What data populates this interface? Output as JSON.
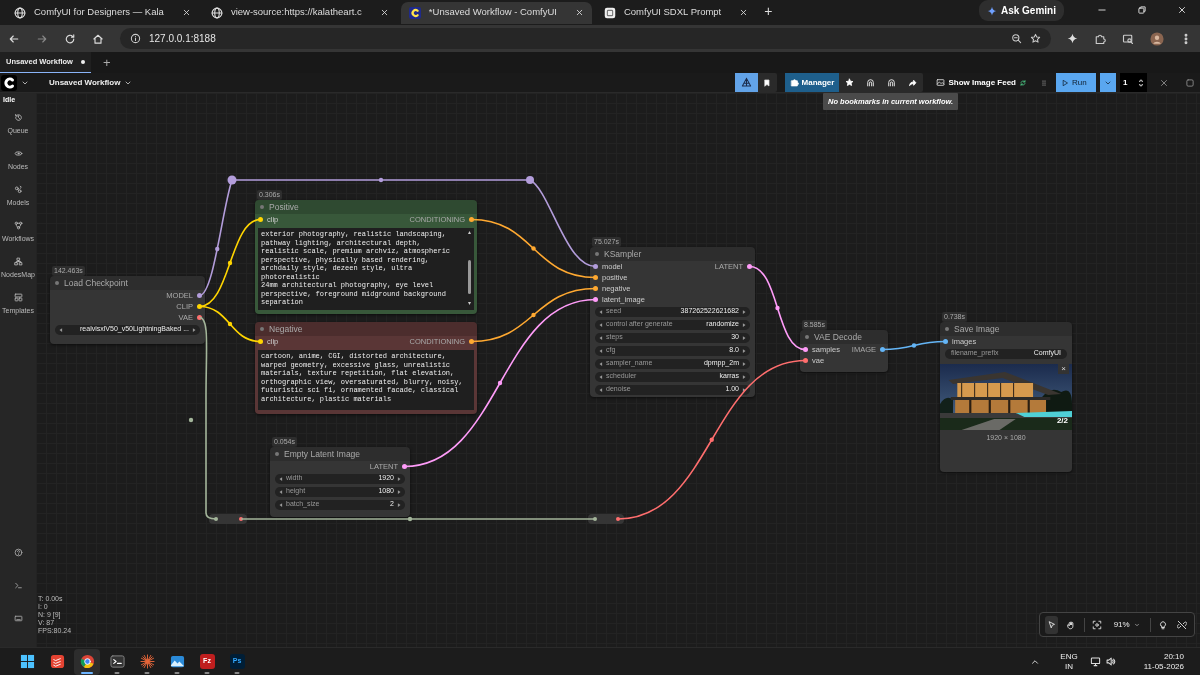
{
  "browser": {
    "tabs": [
      {
        "kind": "web",
        "title": "ComfyUI for Designers — Kala",
        "selected": false
      },
      {
        "kind": "web",
        "title": "view-source:https://kalatheart.c",
        "selected": false
      },
      {
        "kind": "comfy",
        "title": "*Unsaved Workflow - ComfyUI",
        "selected": true
      },
      {
        "kind": "app",
        "title": "ComfyUI SDXL Prompt",
        "selected": false
      }
    ],
    "new_tab": "+",
    "assistant": "Ask Gemini",
    "address": "127.0.0.1:8188"
  },
  "workflow_tabs": [
    {
      "label": "Unsaved Workflow",
      "selected": true,
      "unsaved": true
    }
  ],
  "add_workflow": "+",
  "menu": {
    "workflow_name": "Unsaved Workflow",
    "tools": [
      {
        "kind": "focus",
        "active": true
      },
      {
        "kind": "bookmark",
        "active": false
      }
    ],
    "manager": "Manager",
    "image_feed": "Show Image Feed",
    "run": "Run",
    "batch_count": "1",
    "tooltip": "No bookmarks in current workflow."
  },
  "status": "Idle",
  "sidebar": {
    "items": [
      {
        "kind": "queue",
        "label": "Queue"
      },
      {
        "kind": "nodes",
        "label": "Nodes"
      },
      {
        "kind": "models",
        "label": "Models"
      },
      {
        "kind": "workflows",
        "label": "Workflows"
      },
      {
        "kind": "map",
        "label": "NodesMap"
      },
      {
        "kind": "templates",
        "label": "Templates"
      }
    ]
  },
  "nodes": [
    {
      "kind": "loader",
      "title": "Load Checkpoint",
      "timing": "142.463s",
      "outputs": [
        {
          "label": "MODEL",
          "color": "#b39ddb"
        },
        {
          "label": "CLIP",
          "color": "#ffd500"
        },
        {
          "label": "VAE",
          "color": "#ff6e6e"
        }
      ],
      "widgets": [
        {
          "kind": "combo",
          "value": "realvisxlV50_v50LightningBaked ..."
        }
      ]
    },
    {
      "kind": "prompt",
      "title": "Positive",
      "timing": "0.306s",
      "color": "#38583a",
      "inputs": [
        {
          "label": "clip",
          "color": "#ffd500"
        }
      ],
      "outputs": [
        {
          "label": "CONDITIONING",
          "color": "#ffa931"
        }
      ],
      "text_lines": [
        "exterior photography, realistic landscaping,",
        "pathway lighting, architectural depth,",
        "realistic scale, premium archviz, atmospheric",
        "perspective, physically based rendering,",
        "archdaily style, dezeen style, ultra",
        "photorealistic",
        "24mm architectural photography, eye level",
        "perspective, foreground midground background",
        "separation"
      ]
    },
    {
      "kind": "prompt",
      "title": "Negative",
      "color": "#5a3636",
      "inputs": [
        {
          "label": "clip",
          "color": "#ffd500"
        }
      ],
      "outputs": [
        {
          "label": "CONDITIONING",
          "color": "#ffa931"
        }
      ],
      "text_lines": [
        "cartoon, anime, CGI, distorted architecture,",
        "warped geometry, excessive glass, unrealistic",
        "materials, texture repetition, flat elevation,",
        "orthographic view, oversaturated, blurry, noisy,",
        "futuristic sci fi, ornamented facade, classical",
        "architecture, plastic materials"
      ]
    },
    {
      "kind": "latent",
      "title": "Empty Latent Image",
      "timing": "0.054s",
      "outputs": [
        {
          "label": "LATENT",
          "color": "#ff9cf9"
        }
      ],
      "widgets": [
        {
          "kind": "number",
          "label": "width",
          "value": "1920"
        },
        {
          "kind": "number",
          "label": "height",
          "value": "1080"
        },
        {
          "kind": "number",
          "label": "batch_size",
          "value": "2"
        }
      ]
    },
    {
      "kind": "sampler",
      "title": "KSampler",
      "timing": "75.027s",
      "inputs": [
        {
          "label": "model",
          "color": "#b39ddb"
        },
        {
          "label": "positive",
          "color": "#ffa931"
        },
        {
          "label": "negative",
          "color": "#ffa931"
        },
        {
          "label": "latent_image",
          "color": "#ff9cf9"
        }
      ],
      "outputs": [
        {
          "label": "LATENT",
          "color": "#ff9cf9"
        }
      ],
      "widgets": [
        {
          "kind": "number",
          "label": "seed",
          "value": "387262522621682"
        },
        {
          "kind": "combo",
          "label": "control after generate",
          "value": "randomize"
        },
        {
          "kind": "number",
          "label": "steps",
          "value": "30"
        },
        {
          "kind": "number",
          "label": "cfg",
          "value": "8.0"
        },
        {
          "kind": "combo",
          "label": "sampler_name",
          "value": "dpmpp_2m"
        },
        {
          "kind": "combo",
          "label": "scheduler",
          "value": "karras"
        },
        {
          "kind": "number",
          "label": "denoise",
          "value": "1.00"
        }
      ]
    },
    {
      "kind": "decode",
      "title": "VAE Decode",
      "timing": "8.585s",
      "inputs": [
        {
          "label": "samples",
          "color": "#ff9cf9"
        },
        {
          "label": "vae",
          "color": "#ff6e6e"
        }
      ],
      "outputs": [
        {
          "label": "IMAGE",
          "color": "#64b5f6"
        }
      ]
    },
    {
      "kind": "save",
      "title": "Save Image",
      "timing": "0.738s",
      "inputs": [
        {
          "label": "images",
          "color": "#64b5f6"
        }
      ],
      "widgets": [
        {
          "kind": "text",
          "label": "filename_prefix",
          "value": "ComfyUI"
        }
      ],
      "preview": {
        "kind": "picture",
        "size": "1920 × 1080",
        "counter": "2/2",
        "close": "×"
      }
    }
  ],
  "stats": [
    "T: 0.00s",
    "I: 0",
    "N: 9 [9]",
    "V: 87",
    "FPS:80.24"
  ],
  "canvas_toolbar": {
    "tools": [
      {
        "kind": "select",
        "selected": true
      },
      {
        "kind": "pan",
        "selected": false
      }
    ],
    "zoom": "91%"
  },
  "taskbar": {
    "apps": [
      {
        "kind": "start",
        "running": false,
        "selected": false
      },
      {
        "kind": "tasks",
        "running": false,
        "selected": false
      },
      {
        "kind": "browser",
        "running": true,
        "selected": true
      },
      {
        "kind": "terminal",
        "running": true,
        "selected": false
      },
      {
        "kind": "burst",
        "running": true,
        "selected": false
      },
      {
        "kind": "photos",
        "running": true,
        "selected": false
      },
      {
        "kind": "ftp",
        "label": "Fz",
        "running": true,
        "selected": false
      },
      {
        "kind": "photoshop",
        "label": "Ps",
        "running": true,
        "selected": false
      }
    ],
    "language": "ENG",
    "region": "IN",
    "time": "20:10",
    "date": "11-05-2026"
  }
}
